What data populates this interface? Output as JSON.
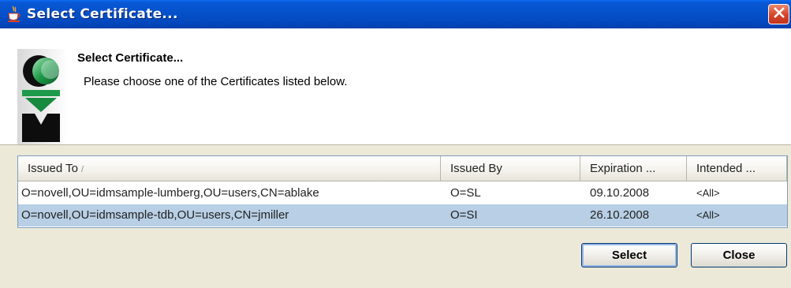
{
  "window": {
    "title": "Select Certificate...",
    "title_icon": "java-cup-icon",
    "close_icon": "close-icon"
  },
  "header": {
    "title": "Select Certificate...",
    "description": "Please choose one of the Certificates listed below.",
    "logo": "novell-logo"
  },
  "table": {
    "columns": [
      {
        "label": "Issued To",
        "sorted": "ascending"
      },
      {
        "label": "Issued By"
      },
      {
        "label": "Expiration ..."
      },
      {
        "label": "Intended ..."
      }
    ],
    "rows": [
      {
        "issued_to": "O=novell,OU=idmsample-lumberg,OU=users,CN=ablake",
        "issued_by": "O=SL",
        "expiration": "09.10.2008",
        "intended": "<All>",
        "selected": false
      },
      {
        "issued_to": "O=novell,OU=idmsample-tdb,OU=users,CN=jmiller",
        "issued_by": "O=SI",
        "expiration": "26.10.2008",
        "intended": "<All>",
        "selected": true
      }
    ]
  },
  "buttons": {
    "select_label": "Select",
    "close_label": "Close"
  },
  "colors": {
    "titlebar": "#0450c8",
    "selection": "#b8cfe5",
    "dialog_bg": "#ece9d8",
    "close_button": "#d5432a"
  }
}
